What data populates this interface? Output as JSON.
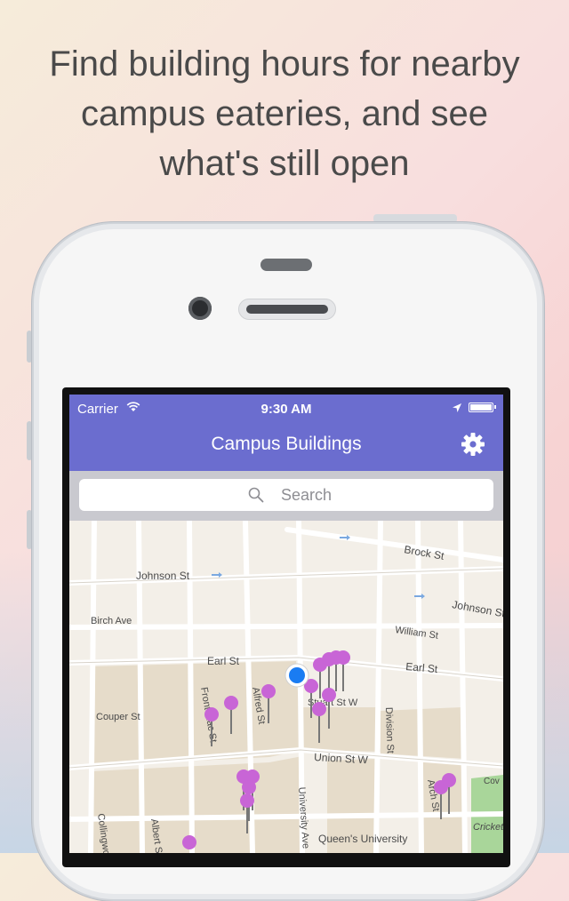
{
  "headline": {
    "line1": "Find building hours for nearby",
    "line2": "campus eateries, and see",
    "line3": "what's still open"
  },
  "status_bar": {
    "carrier": "Carrier",
    "time": "9:30 AM",
    "icons": [
      "wifi-icon",
      "location-arrow-icon",
      "battery-icon"
    ]
  },
  "nav": {
    "title": "Campus Buildings",
    "settings_icon": "gear-icon",
    "color": "#6b6dcf"
  },
  "search": {
    "placeholder": "Search"
  },
  "map": {
    "streets": {
      "brock": "Brock St",
      "johnson_left": "Johnson St",
      "johnson_right": "Johnson St",
      "birch": "Birch Ave",
      "william": "William St",
      "earl_left": "Earl St",
      "earl_right": "Earl St",
      "stuart": "Stuart St W",
      "couper": "Couper St",
      "frontenac": "Frontenac St",
      "alfred": "Alfred St",
      "division": "Division St",
      "union": "Union St W",
      "university": "University Ave",
      "arch": "Arch St",
      "collingwood": "Collingwood St",
      "albert": "Albert St",
      "queens": "Queen's University",
      "cricket": "Cricket",
      "cov": "Cov"
    },
    "pin_color": "#c865d6",
    "user_location_color": "#1a7cf2"
  }
}
